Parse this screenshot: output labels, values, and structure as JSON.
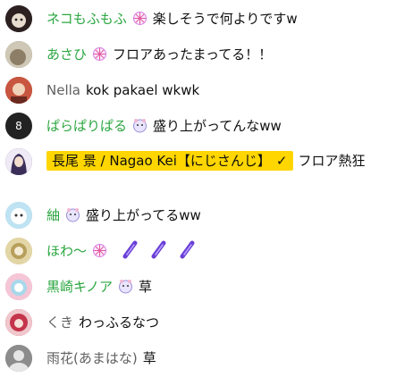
{
  "messages": [
    {
      "author": "ネコもふもふ",
      "badge": "sparkle-badge-icon",
      "text": "楽しそうで何よりですw",
      "avatar_color": "#3a2a2a"
    },
    {
      "author": "あさひ",
      "badge": "sparkle-badge-icon",
      "text": "フロアあったまってる！！",
      "avatar_color": "#7b6f5a"
    },
    {
      "author": "Nella",
      "badge": "",
      "text": "kok pakael wkwk",
      "avatar_color": "#b94b3b"
    },
    {
      "author": "ぱらぱりぱる",
      "badge": "hamster-badge-icon",
      "text": "盛り上がってんなww",
      "avatar_color": "#222222",
      "avatar_text": "8"
    },
    {
      "author": "長尾 景 / Nagao Kei【にじさんじ】",
      "badge": "verified-check-icon",
      "text": "フロア熱狂",
      "avatar_color": "#4b3a6b"
    },
    {
      "author": "紬",
      "badge": "hamster-badge-icon",
      "text": "盛り上がってるww",
      "avatar_color": "#8ccbe6"
    },
    {
      "author": "ほわ～",
      "badge": "sparkle-badge-icon",
      "text": "",
      "emotes": [
        "glowstick-icon",
        "glowstick-icon",
        "glowstick-icon"
      ],
      "avatar_color": "#c9b57d"
    },
    {
      "author": "黒崎キノア",
      "badge": "hamster-badge-icon",
      "text": "草",
      "avatar_color": "#e9a0b6"
    },
    {
      "author": "くき",
      "badge": "",
      "text": "わっふるなつ",
      "avatar_color": "#c4344a"
    },
    {
      "author": "雨花(あまはな)",
      "badge": "",
      "text": "草",
      "avatar_color": "#909090"
    }
  ]
}
